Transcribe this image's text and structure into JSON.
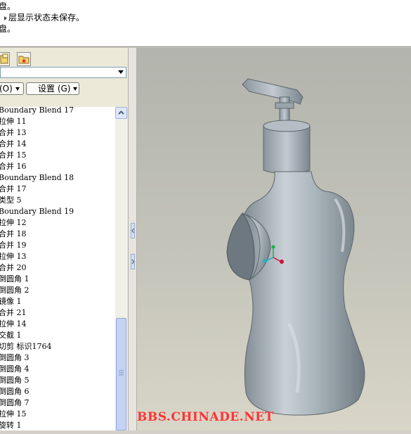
{
  "messages": [
    "盘。",
    "层显示状态未保存。",
    "盘。"
  ],
  "toolbar": {
    "dropdown1_label": "(O)",
    "dropdown2_label": "设置 (G)"
  },
  "tree": {
    "items": [
      "Boundary Blend 17",
      "拉伸 11",
      "合并 13",
      "合并 14",
      "合并 15",
      "合并 16",
      "Boundary Blend 18",
      "合并 17",
      "类型 5",
      "Boundary Blend 19",
      "拉伸 12",
      "合并 18",
      "合并 19",
      "拉伸 13",
      "合并 20",
      "倒圆角 1",
      "倒圆角 2",
      "镜像 1",
      "合并 21",
      "拉伸 14",
      "交截 1",
      "切剪 标识1764",
      "倒圆角 3",
      "倒圆角 4",
      "倒圆角 5",
      "倒圆角 6",
      "倒圆角 7",
      "拉伸 15",
      "旋转 1"
    ]
  },
  "watermark": "BBS.CHINADE.NET",
  "colors": {
    "model": "#a9b3ba",
    "axis_x": "#d0103a",
    "axis_y": "#19b34a",
    "axis_z": "#19b3c8",
    "watermark": "#ff3333"
  }
}
